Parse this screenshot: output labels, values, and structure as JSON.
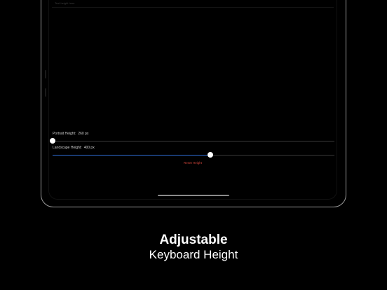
{
  "screen": {
    "text_field": {
      "placeholder": "Test height here"
    },
    "portrait_slider": {
      "label": "Portrait Height:",
      "value_text": "260 px",
      "level": 0.0
    },
    "landscape_slider": {
      "label": "Landscape Height:",
      "value_text": "400 px",
      "level": 0.56
    },
    "reset_label": "Reset Height"
  },
  "caption": {
    "title": "Adjustable",
    "subtitle": "Keyboard Height"
  },
  "colors": {
    "background": "#000000",
    "accent": "#2f6fd8",
    "reset": "#d0453a"
  }
}
